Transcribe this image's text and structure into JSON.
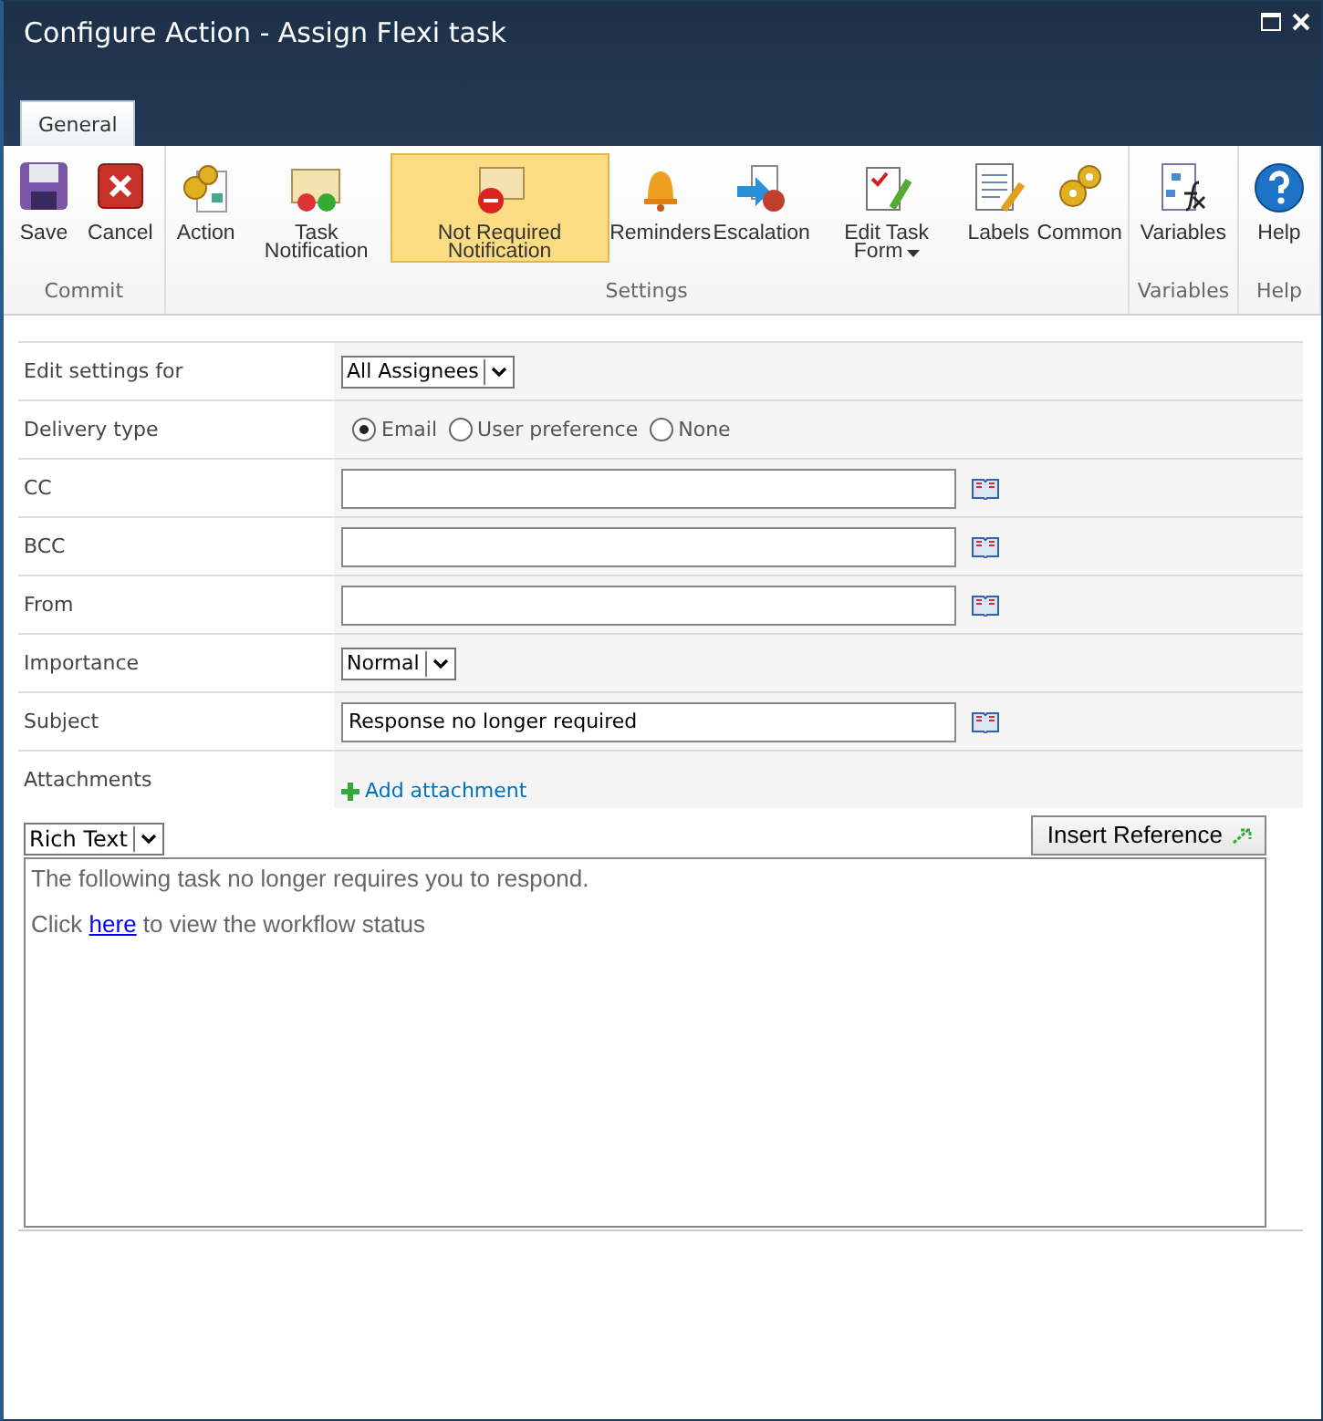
{
  "window": {
    "title": "Configure Action - Assign Flexi task"
  },
  "tabs": [
    {
      "label": "General",
      "selected": true
    }
  ],
  "ribbon": {
    "groups": [
      {
        "label": "Commit",
        "buttons": [
          {
            "label": "Save",
            "selected": false
          },
          {
            "label": "Cancel",
            "selected": false
          }
        ]
      },
      {
        "label": "Settings",
        "buttons": [
          {
            "label": "Action",
            "selected": false
          },
          {
            "label": "Task Notification",
            "selected": false
          },
          {
            "label": "Not Required Notification",
            "selected": true
          },
          {
            "label": "Reminders",
            "selected": false
          },
          {
            "label": "Escalation",
            "selected": false
          },
          {
            "label": "Edit Task Form",
            "selected": false,
            "has_menu": true
          },
          {
            "label": "Labels",
            "selected": false
          },
          {
            "label": "Common",
            "selected": false
          }
        ]
      },
      {
        "label": "Variables",
        "buttons": [
          {
            "label": "Variables",
            "selected": false
          }
        ]
      },
      {
        "label": "Help",
        "buttons": [
          {
            "label": "Help",
            "selected": false
          }
        ]
      }
    ]
  },
  "form": {
    "rows": [
      {
        "kind": "select",
        "label": "Edit settings for",
        "value": "All Assignees"
      },
      {
        "kind": "radio",
        "label": "Delivery type",
        "options": [
          {
            "label": "Email",
            "selected": true
          },
          {
            "label": "User preference",
            "selected": false
          },
          {
            "label": "None",
            "selected": false
          }
        ]
      },
      {
        "kind": "text",
        "label": "CC"
      },
      {
        "kind": "text",
        "label": "BCC"
      },
      {
        "kind": "text",
        "label": "From"
      },
      {
        "kind": "select",
        "label": "Importance",
        "value": "Normal"
      },
      {
        "kind": "text",
        "label": "Subject",
        "value": "Response no longer required"
      },
      {
        "kind": "link",
        "label": "Attachments",
        "value": "Add attachment"
      }
    ]
  },
  "editor": {
    "format": "Rich Text",
    "insert_button": "Insert Reference",
    "paragraphs": [
      {
        "before": "The following task no longer requires you to respond."
      },
      {
        "before": "Click ",
        "link": "here",
        "after": " to view the workflow status"
      }
    ]
  }
}
